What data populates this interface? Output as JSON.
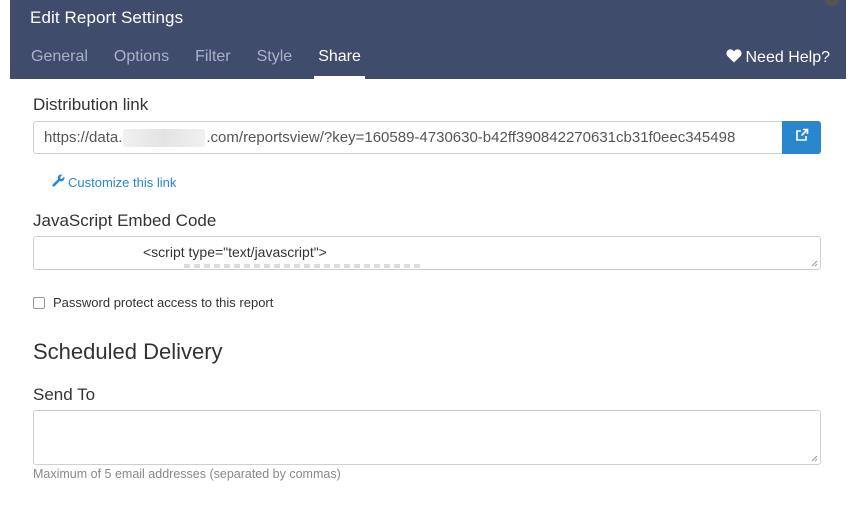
{
  "dialog": {
    "title": "Edit Report Settings",
    "tabs": [
      {
        "label": "General"
      },
      {
        "label": "Options"
      },
      {
        "label": "Filter"
      },
      {
        "label": "Style"
      },
      {
        "label": "Share"
      }
    ],
    "active_tab": "Share",
    "help_label": "Need Help?"
  },
  "distribution": {
    "label": "Distribution link",
    "url_prefix": "https://data.",
    "url_suffix": ".com/reportsview/?key=160589-4730630-b42ff390842270631cb31f0eec345498",
    "customize_label": "Customize this link"
  },
  "embed": {
    "label": "JavaScript Embed Code",
    "code_line": "<script type=\"text/javascript\">"
  },
  "password": {
    "label": "Password protect access to this report",
    "checked": false
  },
  "scheduled": {
    "title": "Scheduled Delivery",
    "send_to_label": "Send To",
    "send_to_value": "",
    "hint": "Maximum of 5 email addresses (separated by commas)"
  },
  "colors": {
    "header_bg": "#3f4c6b",
    "accent": "#2a86cc"
  }
}
